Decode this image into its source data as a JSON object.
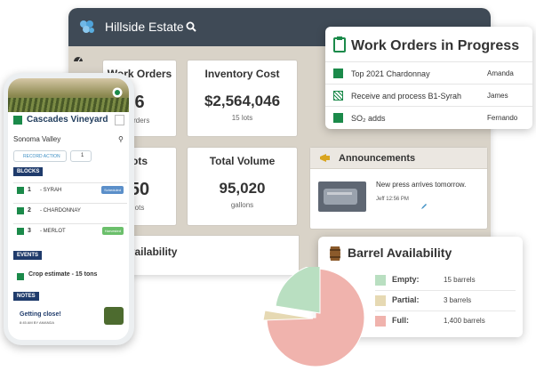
{
  "app": {
    "title": "Hillside Estate"
  },
  "tiles": [
    {
      "label": "Work Orders",
      "value": "6",
      "sub": "orders"
    },
    {
      "label": "Inventory Cost",
      "value": "$2,564,046",
      "sub": "15 lots"
    },
    {
      "label": "ots",
      "value": "50",
      "sub": "ots"
    },
    {
      "label": "Total Volume",
      "value": "95,020",
      "sub": "gallons"
    }
  ],
  "announcements": {
    "title": "Announcements",
    "text": "New press arrives tomorrow.",
    "meta": "Jeff 12:56 PM"
  },
  "availability": {
    "title": "k Availability"
  },
  "work_orders": {
    "title": "Work Orders in Progress",
    "rows": [
      {
        "name": "Top 2021 Chardonnay",
        "person": "Amanda"
      },
      {
        "name": "Receive and process B1-Syrah",
        "person": "James"
      },
      {
        "name": "SO₂ adds",
        "person": "Fernando"
      }
    ]
  },
  "barrel": {
    "title": "Barrel Availability",
    "rows": [
      {
        "label": "Empty:",
        "value": "15 barrels",
        "color": "#b9dfc1"
      },
      {
        "label": "Partial:",
        "value": "3 barrels",
        "color": "#e6d9b3"
      },
      {
        "label": "Full:",
        "value": "1,400 barrels",
        "color": "#f0b3ad"
      }
    ]
  },
  "phone": {
    "vineyard": "Cascades Vineyard",
    "region": "Sonoma Valley",
    "record_action": "RECORD ACTION",
    "count": "1",
    "blocks_label": "BLOCKS",
    "blocks": [
      {
        "num": "1",
        "variety": "- SYRAH",
        "tag": "Scheduled",
        "tag_color": "#5b8fc9"
      },
      {
        "num": "2",
        "variety": "- CHARDONNAY",
        "tag": "",
        "tag_color": ""
      },
      {
        "num": "3",
        "variety": "- MERLOT",
        "tag": "Harvested",
        "tag_color": "#6bbf6b"
      }
    ],
    "events_label": "EVENTS",
    "event": "Crop estimate - 15 tons",
    "notes_label": "NOTES",
    "note_title": "Getting close!",
    "note_meta": "8:45 AM BY AMANDA"
  }
}
